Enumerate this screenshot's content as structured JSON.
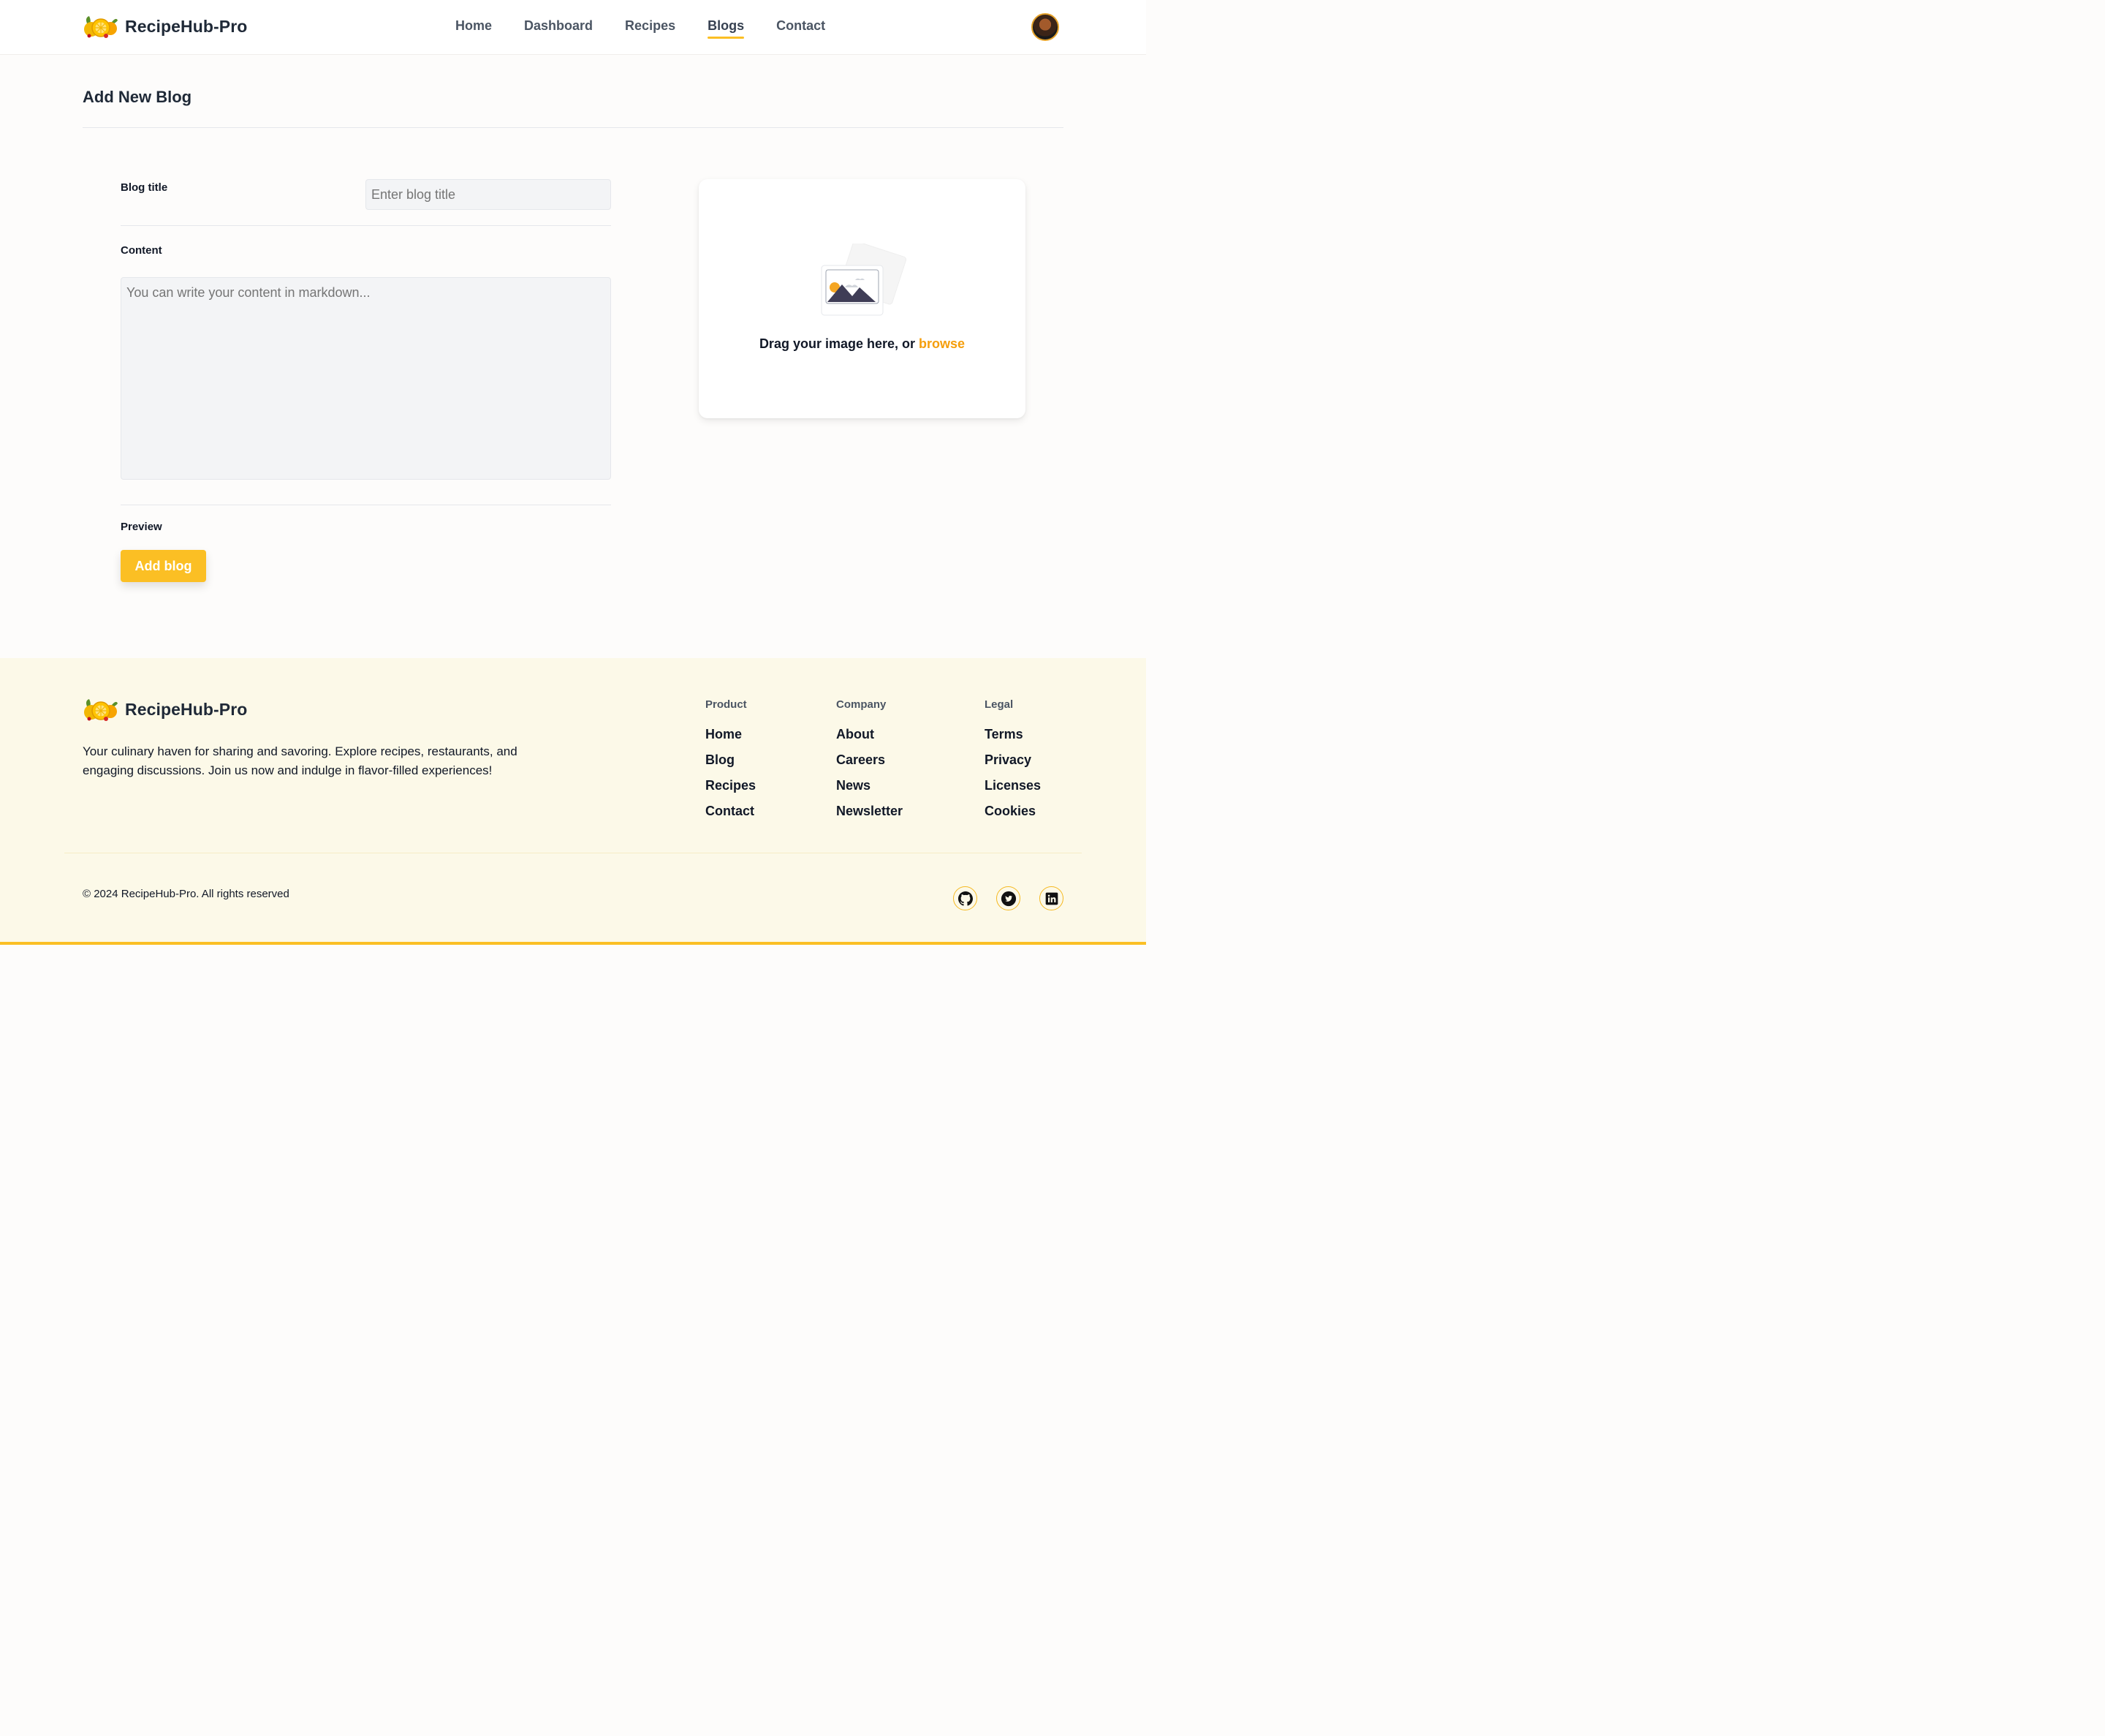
{
  "header": {
    "brand": "RecipeHub-Pro",
    "nav": [
      {
        "label": "Home",
        "active": false
      },
      {
        "label": "Dashboard",
        "active": false
      },
      {
        "label": "Recipes",
        "active": false
      },
      {
        "label": "Blogs",
        "active": true
      },
      {
        "label": "Contact",
        "active": false
      }
    ]
  },
  "page": {
    "title": "Add New Blog"
  },
  "form": {
    "title_label": "Blog title",
    "title_placeholder": "Enter blog title",
    "title_value": "",
    "content_label": "Content",
    "content_placeholder": "You can write your content in markdown...",
    "content_value": "",
    "preview_label": "Preview",
    "submit_label": "Add blog"
  },
  "dropzone": {
    "text": "Drag your image here, or ",
    "browse_label": "browse"
  },
  "footer": {
    "brand": "RecipeHub-Pro",
    "description": "Your culinary haven for sharing and savoring. Explore recipes, restaurants, and engaging discussions. Join us now and indulge in flavor-filled experiences!",
    "columns": [
      {
        "heading": "Product",
        "links": [
          "Home",
          "Blog",
          "Recipes",
          "Contact"
        ]
      },
      {
        "heading": "Company",
        "links": [
          "About",
          "Careers",
          "News",
          "Newsletter"
        ]
      },
      {
        "heading": "Legal",
        "links": [
          "Terms",
          "Privacy",
          "Licenses",
          "Cookies"
        ]
      }
    ],
    "copyright": "© 2024 RecipeHub-Pro. All rights reserved",
    "social": [
      "github-icon",
      "twitter-icon",
      "linkedin-icon"
    ]
  },
  "colors": {
    "accent": "#fbbf24",
    "browse": "#f59e0b",
    "footer_bg": "#fcf9e8"
  }
}
